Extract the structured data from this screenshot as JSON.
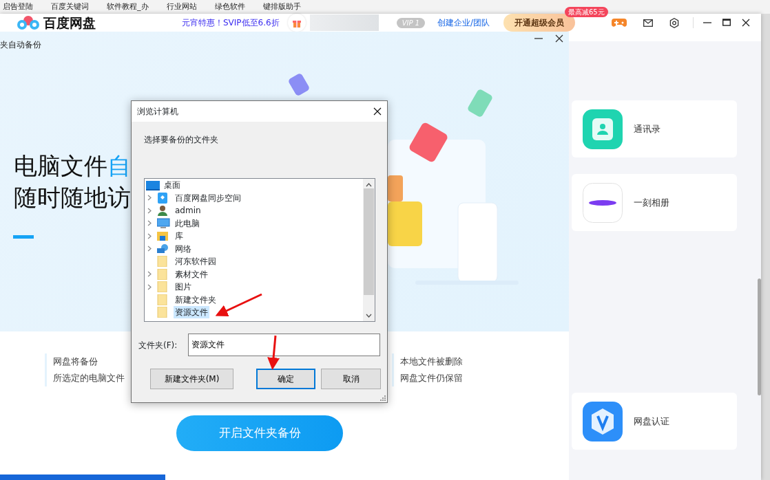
{
  "browser_bookmarks": [
    "启告登陆",
    "百度关键词",
    "软件教程_办",
    "行业网站",
    "绿色软件",
    "键排版助手"
  ],
  "app": {
    "title": "百度网盘",
    "promo": "元宵特惠！SVIP低至6.6折",
    "vip_level": "VIP 1",
    "team_link": "创建企业/团队",
    "upgrade_button": "开通超级会员",
    "upgrade_badge": "最高减65元"
  },
  "backup_panel": {
    "title": "夹自动备份",
    "headline_lines": [
      [
        {
          "text": "电脑文件",
          "highlight": false
        },
        {
          "text": "自",
          "highlight": true
        }
      ],
      [
        {
          "text": "随时随地访",
          "highlight": false
        }
      ]
    ],
    "features": [
      {
        "title": "网盘将备份",
        "detail": "所选定的电脑文件"
      },
      {
        "title": "本地文件被删除",
        "detail": "网盘文件仍保留"
      }
    ],
    "start_button": "开启文件夹备份"
  },
  "side_cards": [
    {
      "label": "通讯录",
      "kind": "contacts"
    },
    {
      "label": "一刻相册",
      "kind": "album"
    },
    {
      "label": "网盘认证",
      "kind": "verify"
    }
  ],
  "dialog": {
    "title": "浏览计算机",
    "prompt": "选择要备份的文件夹",
    "tree": [
      {
        "label": "桌面",
        "kind": "desktop",
        "selected": false,
        "children": [
          {
            "label": "百度网盘同步空间",
            "kind": "sync",
            "expandable": true,
            "selected": false
          },
          {
            "label": "admin",
            "kind": "user",
            "expandable": true,
            "selected": false
          },
          {
            "label": "此电脑",
            "kind": "computer",
            "expandable": true,
            "selected": false
          },
          {
            "label": "库",
            "kind": "library",
            "expandable": true,
            "selected": false
          },
          {
            "label": "网络",
            "kind": "network",
            "expandable": true,
            "selected": false
          },
          {
            "label": "河东软件园",
            "kind": "folder",
            "expandable": false,
            "selected": false
          },
          {
            "label": "素材文件",
            "kind": "folder",
            "expandable": true,
            "selected": false
          },
          {
            "label": "图片",
            "kind": "folder",
            "expandable": true,
            "selected": false
          },
          {
            "label": "新建文件夹",
            "kind": "folder",
            "expandable": false,
            "selected": false
          },
          {
            "label": "资源文件",
            "kind": "folder",
            "expandable": false,
            "selected": true
          }
        ]
      }
    ],
    "folder_label": "文件夹(F):",
    "folder_value": "资源文件",
    "buttons": [
      {
        "label": "新建文件夹(M)",
        "default": false
      },
      {
        "label": "确定",
        "default": true
      },
      {
        "label": "取消",
        "default": false
      }
    ]
  }
}
